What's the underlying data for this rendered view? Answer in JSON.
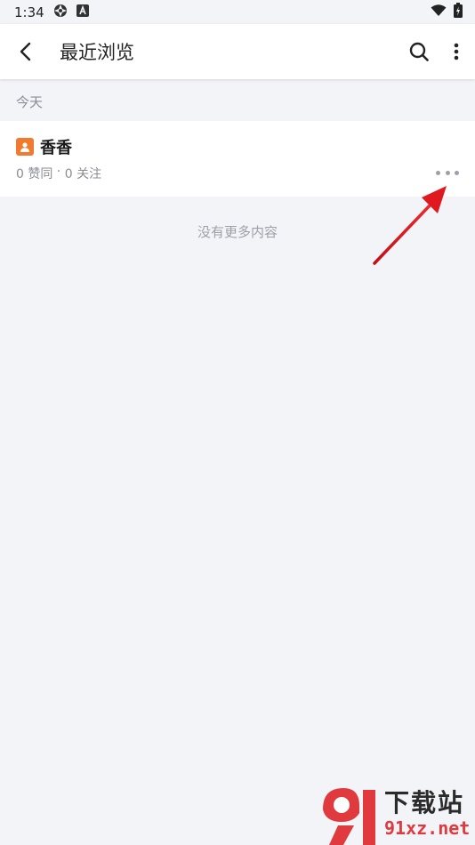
{
  "status_bar": {
    "time": "1:34"
  },
  "app_bar": {
    "title": "最近浏览"
  },
  "section": {
    "header": "今天"
  },
  "history_items": [
    {
      "name": "香香",
      "likes": "0 赞同",
      "separator": " · ",
      "follows": "0 关注"
    }
  ],
  "footer": {
    "no_more": "没有更多内容"
  },
  "watermark": {
    "brand_cn": "下载站",
    "url": "91xz.net"
  },
  "colors": {
    "accent_orange": "#f07a2e",
    "annotation_red": "#e0191f",
    "background": "#f3f4f8",
    "secondary_text": "#8a8d96"
  }
}
